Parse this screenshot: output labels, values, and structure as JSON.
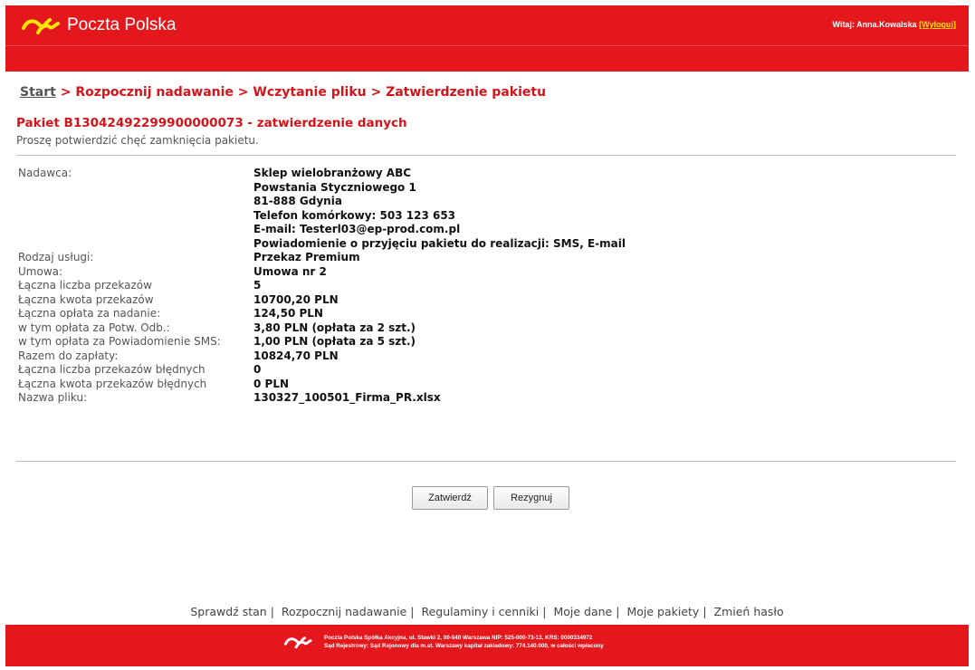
{
  "header": {
    "brand": "Poczta Polska",
    "welcome_prefix": "Witaj: Anna.Kowalska",
    "logout_label": "[Wyloguj]"
  },
  "breadcrumb": {
    "start": "Start",
    "separator": ">",
    "items": [
      "Rozpocznij nadawanie",
      "Wczytanie pliku",
      "Zatwierdzenie pakietu"
    ]
  },
  "package": {
    "title": "Pakiet B13042492299900000073 - zatwierdzenie danych",
    "message": "Proszę potwierdzić chęć zamknięcia pakietu."
  },
  "details": {
    "sender_label": "Nadawca:",
    "sender_lines": [
      "Sklep wielobranżowy ABC",
      "Powstania Styczniowego 1",
      "81-888 Gdynia",
      "Telefon komórkowy: 503 123 653",
      "E-mail: Testerl03@ep-prod.com.pl",
      "Powiadomienie o przyjęciu pakietu do realizacji: SMS, E-mail"
    ],
    "rows": [
      {
        "label": "Rodzaj usługi:",
        "value": "Przekaz Premium"
      },
      {
        "label": "Umowa:",
        "value": "Umowa nr 2"
      },
      {
        "label": "Łączna liczba przekazów",
        "value": "5"
      },
      {
        "label": "Łączna kwota przekazów",
        "value": "10700,20 PLN"
      },
      {
        "label": "Łączna opłata za nadanie:",
        "value": "124,50 PLN"
      },
      {
        "label": "w tym opłata za Potw. Odb.:",
        "value": "3,80 PLN (opłata za 2 szt.)"
      },
      {
        "label": "w tym opłata za Powiadomienie SMS:",
        "value": "1,00 PLN (opłata za 5 szt.)"
      },
      {
        "label": "Razem do zapłaty:",
        "value": "10824,70 PLN"
      },
      {
        "label": "Łączna liczba przekazów błędnych",
        "value": "0"
      },
      {
        "label": "Łączna kwota przekazów błędnych",
        "value": "0 PLN"
      },
      {
        "label": "Nazwa pliku:",
        "value": "130327_100501_Firma_PR.xlsx"
      }
    ]
  },
  "buttons": {
    "confirm": "Zatwierdź",
    "cancel": "Rezygnuj"
  },
  "footer_links": [
    "Sprawdź stan",
    "Rozpocznij nadawanie",
    "Regulaminy i cenniki",
    "Moje dane",
    "Moje pakiety",
    "Zmień hasło"
  ],
  "footer": {
    "line1": "Poczta Polska Spółka Akcyjna, ul. Stawki 2, 00-940 Warszawa NIP: 525-000-73-13, KRS: 0000334972",
    "line2": "Sąd Rejestrowy: Sąd Rejonowy dla m.st. Warszawy kapitał zakładowy: 774.140.000, w całości wpłacony"
  },
  "colors": {
    "brand_red": "#e3171c",
    "accent_yellow": "#ffe600"
  }
}
